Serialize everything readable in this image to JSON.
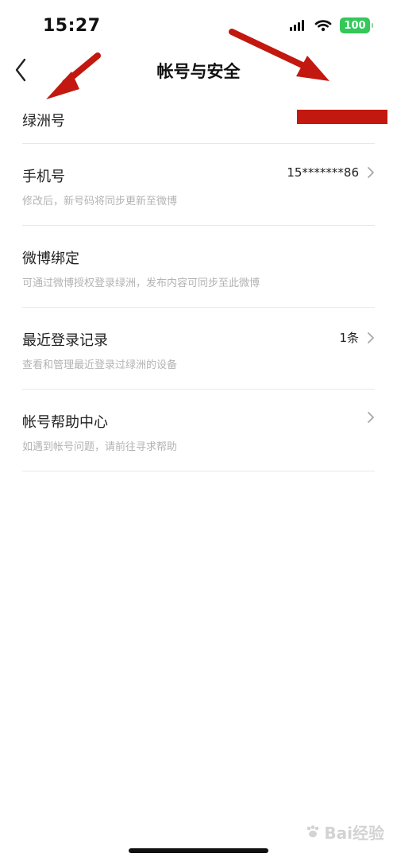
{
  "status_bar": {
    "time": "15:27",
    "battery": "100",
    "icons": [
      "signal-icon",
      "wifi-icon",
      "battery-icon"
    ]
  },
  "header": {
    "title": "帐号与安全",
    "back_icon": "chevron-left-icon"
  },
  "oasis_id": {
    "label": "绿洲号"
  },
  "items": [
    {
      "title": "手机号",
      "subtitle": "修改后，新号码将同步更新至微博",
      "value": "15*******86"
    },
    {
      "title": "微博绑定",
      "subtitle": "可通过微博授权登录绿洲，发布内容可同步至此微博"
    },
    {
      "title": "最近登录记录",
      "subtitle": "查看和管理最近登录过绿洲的设备",
      "value": "1条"
    },
    {
      "title": "帐号帮助中心",
      "subtitle": "如遇到帐号问题，请前往寻求帮助"
    }
  ],
  "colors": {
    "annotation_red": "#c2180f",
    "battery_green": "#34c759",
    "divider": "#e8e8e8",
    "subtitle_gray": "#b3b3b3"
  },
  "watermark": {
    "text": "Bai经验"
  }
}
